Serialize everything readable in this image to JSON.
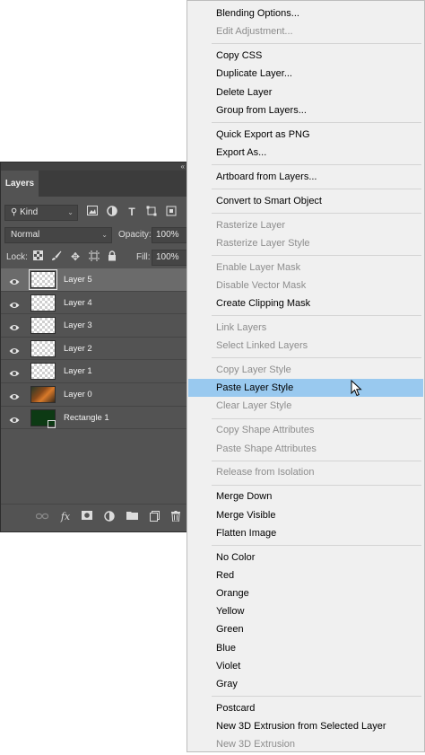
{
  "layers_panel": {
    "tab": "Layers",
    "collapse_glyph": "«",
    "filter_kind": "Kind",
    "blend_mode": "Normal",
    "opacity_label": "Opacity:",
    "opacity_value": "100%",
    "lock_label": "Lock:",
    "fill_label": "Fill:",
    "fill_value": "100%",
    "layers": [
      {
        "name": "Layer 5",
        "selected": true,
        "thumb": "transparent"
      },
      {
        "name": "Layer 4",
        "selected": false,
        "thumb": "transparent"
      },
      {
        "name": "Layer 3",
        "selected": false,
        "thumb": "transparent"
      },
      {
        "name": "Layer 2",
        "selected": false,
        "thumb": "transparent"
      },
      {
        "name": "Layer 1",
        "selected": false,
        "thumb": "transparent"
      },
      {
        "name": "Layer 0",
        "selected": false,
        "thumb": "photo"
      },
      {
        "name": "Rectangle 1",
        "selected": false,
        "thumb": "shape"
      }
    ]
  },
  "context_menu": {
    "highlight_color": "#99c9ef",
    "items": [
      {
        "label": "Blending Options...",
        "disabled": false
      },
      {
        "label": "Edit Adjustment...",
        "disabled": true
      },
      {
        "sep": true
      },
      {
        "label": "Copy CSS",
        "disabled": false
      },
      {
        "label": "Duplicate Layer...",
        "disabled": false
      },
      {
        "label": "Delete Layer",
        "disabled": false
      },
      {
        "label": "Group from Layers...",
        "disabled": false
      },
      {
        "sep": true
      },
      {
        "label": "Quick Export as PNG",
        "disabled": false
      },
      {
        "label": "Export As...",
        "disabled": false
      },
      {
        "sep": true
      },
      {
        "label": "Artboard from Layers...",
        "disabled": false
      },
      {
        "sep": true
      },
      {
        "label": "Convert to Smart Object",
        "disabled": false
      },
      {
        "sep": true
      },
      {
        "label": "Rasterize Layer",
        "disabled": true
      },
      {
        "label": "Rasterize Layer Style",
        "disabled": true
      },
      {
        "sep": true
      },
      {
        "label": "Enable Layer Mask",
        "disabled": true
      },
      {
        "label": "Disable Vector Mask",
        "disabled": true
      },
      {
        "label": "Create Clipping Mask",
        "disabled": false
      },
      {
        "sep": true
      },
      {
        "label": "Link Layers",
        "disabled": true
      },
      {
        "label": "Select Linked Layers",
        "disabled": true
      },
      {
        "sep": true
      },
      {
        "label": "Copy Layer Style",
        "disabled": true
      },
      {
        "label": "Paste Layer Style",
        "disabled": false,
        "highlighted": true
      },
      {
        "label": "Clear Layer Style",
        "disabled": true
      },
      {
        "sep": true
      },
      {
        "label": "Copy Shape Attributes",
        "disabled": true
      },
      {
        "label": "Paste Shape Attributes",
        "disabled": true
      },
      {
        "sep": true
      },
      {
        "label": "Release from Isolation",
        "disabled": true
      },
      {
        "sep": true
      },
      {
        "label": "Merge Down",
        "disabled": false
      },
      {
        "label": "Merge Visible",
        "disabled": false
      },
      {
        "label": "Flatten Image",
        "disabled": false
      },
      {
        "sep": true
      },
      {
        "label": "No Color",
        "disabled": false
      },
      {
        "label": "Red",
        "disabled": false
      },
      {
        "label": "Orange",
        "disabled": false
      },
      {
        "label": "Yellow",
        "disabled": false
      },
      {
        "label": "Green",
        "disabled": false
      },
      {
        "label": "Blue",
        "disabled": false
      },
      {
        "label": "Violet",
        "disabled": false
      },
      {
        "label": "Gray",
        "disabled": false
      },
      {
        "sep": true
      },
      {
        "label": "Postcard",
        "disabled": false
      },
      {
        "label": "New 3D Extrusion from Selected Layer",
        "disabled": false
      },
      {
        "label": "New 3D Extrusion",
        "disabled": true
      }
    ]
  }
}
